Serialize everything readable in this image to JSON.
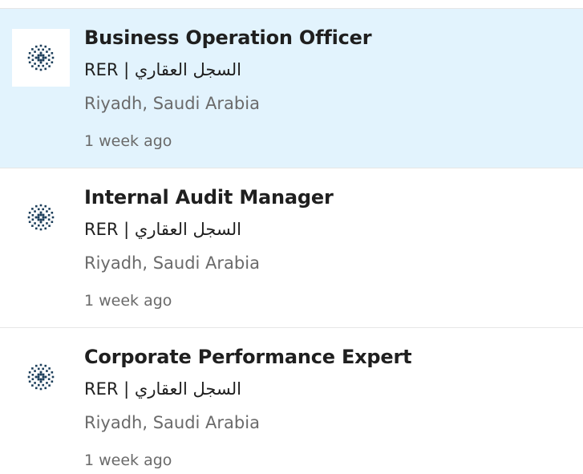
{
  "colors": {
    "selected_bg": "#e2f3fd",
    "logo_color": "#1c3e5a",
    "title_color": "#1f1f1f",
    "meta_color": "#6a6a6a"
  },
  "jobs": [
    {
      "title": "Business Operation Officer",
      "company": "RER | السجل العقاري",
      "location": "Riyadh, Saudi Arabia",
      "posted": "1 week ago",
      "logo_icon": "rer-company-logo-icon",
      "selected": true
    },
    {
      "title": "Internal Audit Manager",
      "company": "RER | السجل العقاري",
      "location": "Riyadh, Saudi Arabia",
      "posted": "1 week ago",
      "logo_icon": "rer-company-logo-icon",
      "selected": false
    },
    {
      "title": "Corporate Performance Expert",
      "company": "RER | السجل العقاري",
      "location": "Riyadh, Saudi Arabia",
      "posted": "1 week ago",
      "logo_icon": "rer-company-logo-icon",
      "selected": false
    }
  ]
}
